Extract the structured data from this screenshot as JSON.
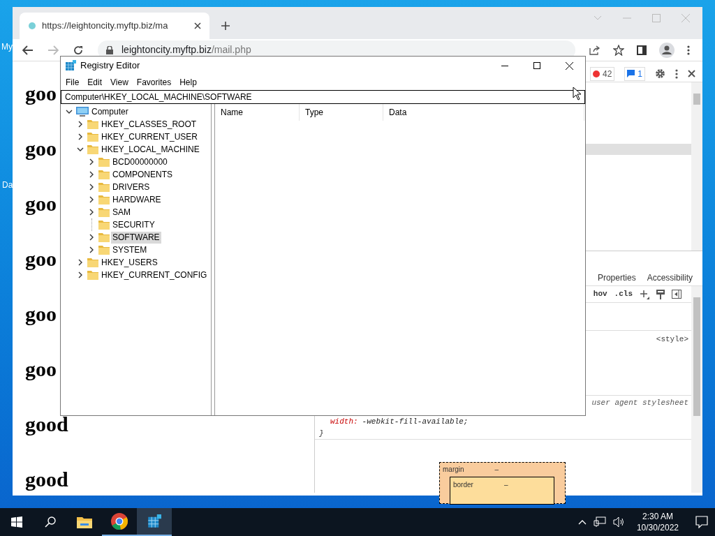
{
  "desktop_icons": [
    {
      "label": "My"
    },
    {
      "label": "Da"
    }
  ],
  "browser": {
    "tab": {
      "title": "https://leightoncity.myftp.biz/ma"
    },
    "address": {
      "host": "leightoncity.myftp.biz",
      "path": "/mail.php"
    },
    "page_lines": [
      "goo",
      "goo",
      "goo",
      "goo",
      "goo",
      "goo",
      "good",
      "good"
    ]
  },
  "devtools": {
    "error_count": "42",
    "message_count": "1",
    "tabs": [
      "Properties",
      "Accessibility"
    ],
    "toolbar": [
      "hov",
      ".cls"
    ],
    "rules": [
      {
        "source": "<style>"
      },
      {
        "source": "user agent stylesheet",
        "declarations": [
          {
            "property": "width:",
            "value": "-webkit-fill-available;"
          }
        ],
        "closing": "}"
      }
    ],
    "box_model": [
      {
        "label": "margin",
        "value": "–"
      },
      {
        "label": "border",
        "value": "–"
      }
    ]
  },
  "regedit": {
    "title": "Registry Editor",
    "menu": [
      "File",
      "Edit",
      "View",
      "Favorites",
      "Help"
    ],
    "address": "Computer\\HKEY_LOCAL_MACHINE\\SOFTWARE",
    "tree": [
      {
        "label": "Computer",
        "kind": "computer",
        "expanded": true,
        "selected": false,
        "children": [
          {
            "label": "HKEY_CLASSES_ROOT",
            "kind": "key",
            "expanded": false,
            "selected": false
          },
          {
            "label": "HKEY_CURRENT_USER",
            "kind": "key",
            "expanded": false,
            "selected": false
          },
          {
            "label": "HKEY_LOCAL_MACHINE",
            "kind": "key",
            "expanded": true,
            "selected": false,
            "children": [
              {
                "label": "BCD00000000",
                "kind": "key",
                "expanded": false,
                "selected": false
              },
              {
                "label": "COMPONENTS",
                "kind": "key",
                "expanded": false,
                "selected": false
              },
              {
                "label": "DRIVERS",
                "kind": "key",
                "expanded": false,
                "selected": false
              },
              {
                "label": "HARDWARE",
                "kind": "key",
                "expanded": false,
                "selected": false
              },
              {
                "label": "SAM",
                "kind": "key",
                "expanded": false,
                "selected": false
              },
              {
                "label": "SECURITY",
                "kind": "empty_key",
                "selected": false
              },
              {
                "label": "SOFTWARE",
                "kind": "key",
                "expanded": false,
                "selected": true
              },
              {
                "label": "SYSTEM",
                "kind": "key",
                "expanded": false,
                "selected": false
              }
            ]
          },
          {
            "label": "HKEY_USERS",
            "kind": "key",
            "expanded": false,
            "selected": false
          },
          {
            "label": "HKEY_CURRENT_CONFIG",
            "kind": "key",
            "expanded": false,
            "selected": false
          }
        ]
      }
    ],
    "columns": [
      "Name",
      "Type",
      "Data"
    ]
  },
  "taskbar": {
    "time": "2:30 AM",
    "date": "10/30/2022"
  }
}
